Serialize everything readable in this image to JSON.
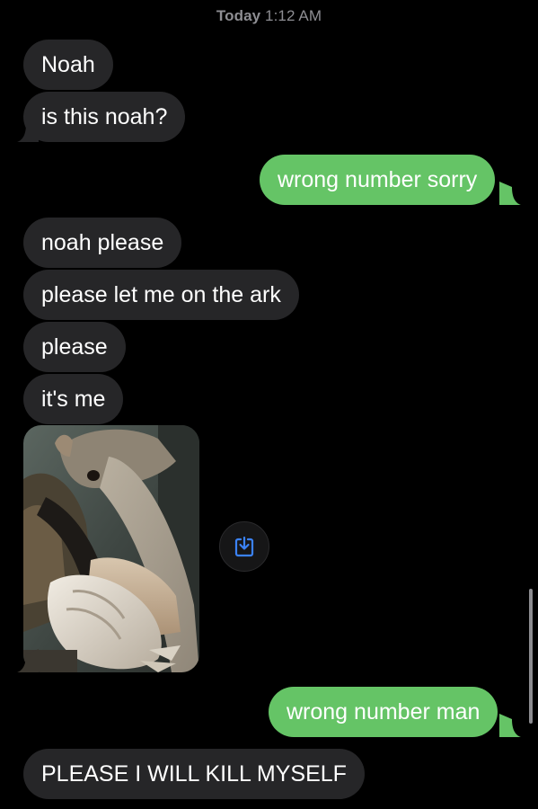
{
  "timestamp": {
    "day": "Today",
    "time": "1:12 AM"
  },
  "messages": [
    {
      "direction": "incoming",
      "text": "Noah"
    },
    {
      "direction": "incoming",
      "text": "is this noah?"
    },
    {
      "direction": "outgoing",
      "text": "wrong number sorry"
    },
    {
      "direction": "incoming",
      "text": "noah please"
    },
    {
      "direction": "incoming",
      "text": "please let me on the ark"
    },
    {
      "direction": "incoming",
      "text": "please"
    },
    {
      "direction": "incoming",
      "text": "it's me"
    },
    {
      "direction": "incoming",
      "type": "photo",
      "subject": "anteater"
    },
    {
      "direction": "outgoing",
      "text": "wrong number man"
    },
    {
      "direction": "incoming",
      "text": "PLEASE I WILL KILL MYSELF"
    }
  ],
  "save_button": {
    "icon": "save-to-photos-icon"
  },
  "colors": {
    "background": "#000000",
    "incoming_bubble": "#262628",
    "outgoing_bubble": "#65c466",
    "timestamp": "#8e8e93",
    "save_icon": "#3b82f6"
  }
}
